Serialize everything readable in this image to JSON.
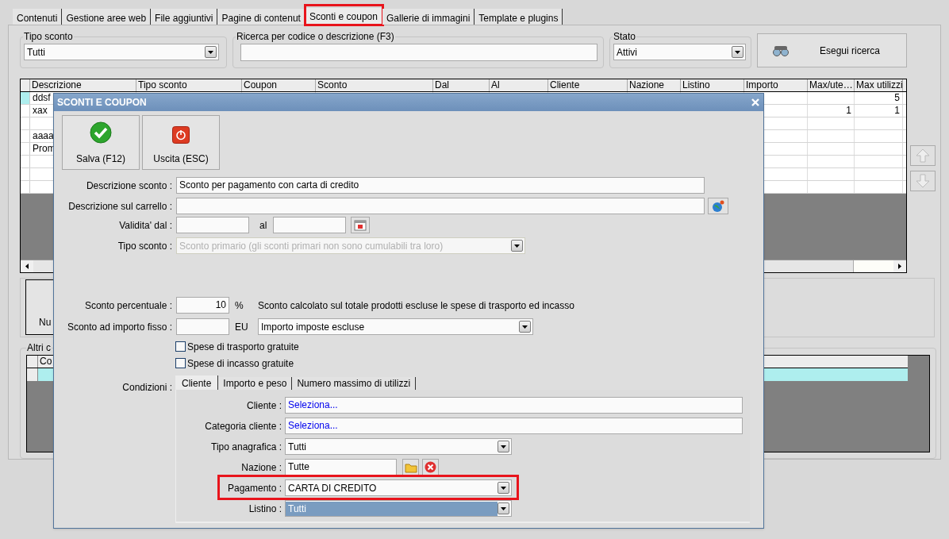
{
  "tabs": [
    {
      "label": "Contenuti",
      "selected": false,
      "highlighted": false
    },
    {
      "label": "Gestione aree web",
      "selected": false,
      "highlighted": false
    },
    {
      "label": "File aggiuntivi",
      "selected": false,
      "highlighted": false
    },
    {
      "label": "Pagine di contenut",
      "selected": false,
      "highlighted": false
    },
    {
      "label": "Sconti e coupon",
      "selected": true,
      "highlighted": true
    },
    {
      "label": "Gallerie di immagini",
      "selected": false,
      "highlighted": false
    },
    {
      "label": "Template e plugins",
      "selected": false,
      "highlighted": false
    }
  ],
  "filters": {
    "tipo_sconto": {
      "label": "Tipo sconto",
      "value": "Tutti"
    },
    "search": {
      "label": "Ricerca per codice o descrizione (F3)"
    },
    "stato": {
      "label": "Stato",
      "value": "Attivi"
    },
    "search_button": "Esegui ricerca"
  },
  "table": {
    "columns": [
      "Descrizione",
      "Tipo sconto",
      "Coupon",
      "Sconto",
      "Dal",
      "Al",
      "Cliente",
      "Nazione",
      "Listino",
      "Importo",
      "Max/ute…",
      "Max utilizzi"
    ],
    "rows": [
      {
        "selected": true,
        "descrizione": "ddsf",
        "max_utilizzi": "5"
      },
      {
        "selected": false,
        "descrizione": "xax",
        "max_utente": "1",
        "max_utilizzi": "1"
      },
      {
        "selected": false
      },
      {
        "selected": false,
        "descrizione": "aaaa"
      },
      {
        "selected": false,
        "descrizione": "Prom"
      },
      {
        "selected": false
      },
      {
        "selected": false
      },
      {
        "selected": false
      }
    ]
  },
  "lower_panel": {
    "new_button": "Nu"
  },
  "other_codes": {
    "title": "Altri c",
    "columns": [
      "Co"
    ]
  },
  "dialog": {
    "title": "SCONTI E COUPON",
    "buttons": [
      {
        "kind": "save",
        "label": "Salva (F12)"
      },
      {
        "kind": "exit",
        "label": "Uscita (ESC)"
      }
    ],
    "descrizione_sconto": {
      "label": "Descrizione sconto :",
      "value": "Sconto per pagamento con carta di credito"
    },
    "descrizione_carrello": {
      "label": "Descrizione sul carrello :"
    },
    "validita": {
      "label": "Validita' dal :",
      "to_label": "al"
    },
    "tipo_sconto": {
      "label": "Tipo sconto :",
      "value": "Sconto primario (gli sconti primari non sono cumulabili tra loro)",
      "disabled": true
    },
    "sconto_percentuale": {
      "label": "Sconto percentuale :",
      "value": "10",
      "unit": "%",
      "note": "Sconto calcolato sul totale prodotti escluse le spese di trasporto ed incasso"
    },
    "sconto_fisso": {
      "label": "Sconto ad importo fisso :",
      "unit": "EU",
      "mode": "Importo imposte escluse"
    },
    "checkboxes": [
      {
        "label": "Spese di trasporto gratuite",
        "checked": false
      },
      {
        "label": "Spese di incasso gratuite",
        "checked": false
      }
    ],
    "conditions": {
      "label": "Condizioni :",
      "tabs": [
        {
          "label": "Cliente",
          "selected": true
        },
        {
          "label": "Importo e peso",
          "selected": false
        },
        {
          "label": "Numero massimo di utilizzi",
          "selected": false
        }
      ],
      "fields": [
        {
          "kind": "picker",
          "label": "Cliente :",
          "value": "Seleziona...",
          "highlighted": false
        },
        {
          "kind": "picker",
          "label": "Categoria cliente :",
          "value": "Seleziona...",
          "highlighted": false
        },
        {
          "kind": "dropdown",
          "label": "Tipo anagrafica :",
          "value": "Tutti",
          "highlighted": false,
          "selected": false
        },
        {
          "kind": "readonly",
          "label": "Nazione :",
          "value": "Tutte",
          "highlighted": false
        },
        {
          "kind": "dropdown",
          "label": "Pagamento :",
          "value": "CARTA DI CREDITO",
          "highlighted": true,
          "selected": false
        },
        {
          "kind": "dropdown",
          "label": "Listino :",
          "value": "Tutti",
          "highlighted": false,
          "selected": true
        }
      ]
    }
  }
}
